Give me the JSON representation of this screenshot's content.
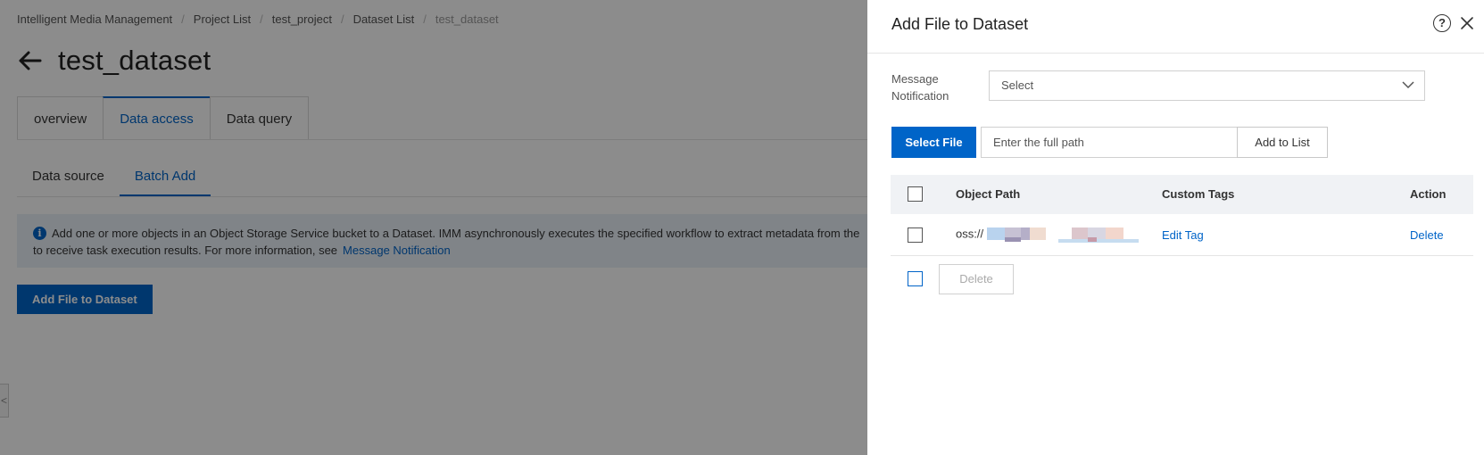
{
  "breadcrumb": {
    "items": [
      "Intelligent Media Management",
      "Project List",
      "test_project",
      "Dataset List",
      "test_dataset"
    ],
    "separator": "/"
  },
  "page": {
    "title": "test_dataset",
    "tabs": [
      "overview",
      "Data access",
      "Data query"
    ],
    "active_tab": "Data access",
    "subtabs": [
      "Data source",
      "Batch Add"
    ],
    "active_subtab": "Batch Add",
    "info_text_line1": "Add one or more objects in an Object Storage Service bucket to a Dataset. IMM asynchronously executes the specified workflow to extract metadata from the",
    "info_text_line2": "to receive task execution results. For more information, see",
    "info_link": "Message Notification",
    "add_file_button": "Add File to Dataset",
    "info_icon": "info-circle-icon"
  },
  "drawer": {
    "title": "Add File to Dataset",
    "help_icon": "question-circle-icon",
    "close_icon": "close-icon",
    "message_notification_label": "Message Notification",
    "message_notification_placeholder": "Select",
    "select_file_button": "Select File",
    "path_placeholder": "Enter the full path",
    "add_to_list_button": "Add to List",
    "table": {
      "columns": [
        "Object Path",
        "Custom Tags",
        "Action"
      ],
      "rows": [
        {
          "object_path": "oss://",
          "custom_tags": "Edit Tag",
          "action": "Delete"
        }
      ]
    },
    "bulk_delete_button": "Delete"
  },
  "colors": {
    "primary": "#0064c8",
    "overlay": "rgba(0,0,0,0.45)",
    "info_bg": "#e9f0f8"
  }
}
